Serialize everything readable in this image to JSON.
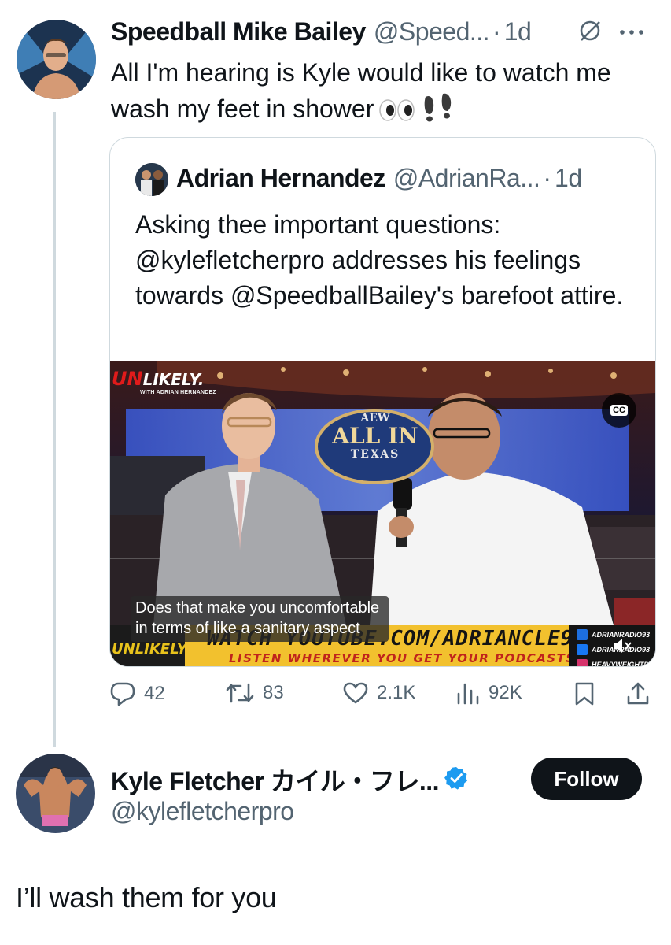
{
  "tweet1": {
    "author_name": "Speedball Mike Bailey",
    "handle": "@Speed...",
    "dot": "·",
    "time": "1d",
    "text": "All I'm hearing is Kyle would like to watch me wash my feet in shower",
    "emojis": [
      "eyes-emoji",
      "footprints-emoji"
    ]
  },
  "quote": {
    "author_name": "Adrian Hernandez",
    "handle": "@AdrianRa...",
    "dot": "·",
    "time": "1d",
    "text": "Asking thee important questions: @kylefletcherpro addresses his feelings towards @SpeedballBailey's barefoot attire.",
    "video": {
      "brand_un": "UN",
      "brand_likely": "LIKELY.",
      "brand_sub": "WITH ADRIAN HERNANDEZ",
      "cc_label": "CC",
      "sign_line1": "AEW",
      "sign_line2": "ALL IN",
      "sign_line3": "TEXAS",
      "caption_line1": "Does that make you uncomfortable",
      "caption_line2": "in terms of like a sanitary aspect",
      "banner_left": "UNLIKELY.",
      "banner_main": "WATCH YOUTUBE.COM/ADRIANCLE93",
      "banner_sub": "LISTEN WHEREVER YOU GET YOUR PODCASTS",
      "social": [
        "ADRIANRADIO93",
        "ADRIANRADIO93",
        "HEAVYWEIGHTP"
      ]
    }
  },
  "actions": {
    "replies": "42",
    "reposts": "83",
    "likes": "2.1K",
    "views": "92K"
  },
  "tweet2": {
    "author_name": "Kyle Fletcher カイル・フレ...",
    "handle": "@kylefletcherpro",
    "follow_label": "Follow",
    "text": "I’ll wash them for you"
  },
  "colors": {
    "text": "#0f1419",
    "muted": "#536471",
    "border": "#cfd9de",
    "verified": "#1d9bf0",
    "banner_yellow": "#f2c12e"
  }
}
